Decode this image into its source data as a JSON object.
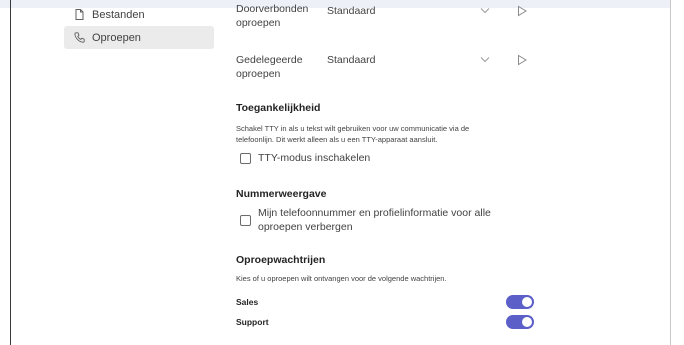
{
  "sidebar": {
    "items": [
      {
        "label": "Bestanden",
        "icon": "file-icon"
      },
      {
        "label": "Oproepen",
        "icon": "phone-icon",
        "active": true
      }
    ]
  },
  "calls": {
    "forwarded": {
      "label_line1": "Doorverbonden",
      "label_line2": "oproepen",
      "value": "Standaard"
    },
    "delegated": {
      "label_line1": "Gedelegeerde",
      "label_line2": "oproepen",
      "value": "Standaard"
    }
  },
  "accessibility": {
    "title": "Toegankelijkheid",
    "description_line1": "Schakel TTY in als u tekst wilt gebruiken voor uw communicatie via de",
    "description_line2": "telefoonlijn. Dit werkt alleen als u een TTY-apparaat aansluit.",
    "tty_label": "TTY-modus inschakelen",
    "tty_checked": false
  },
  "caller_id": {
    "title": "Nummerweergave",
    "hide_label_line1": "Mijn telefoonnummer en profielinformatie voor alle",
    "hide_label_line2": "oproepen verbergen",
    "hide_checked": false
  },
  "call_queues": {
    "title": "Oproepwachtrijen",
    "description": "Kies of u oproepen wilt ontvangen voor de volgende wachtrijen.",
    "queues": [
      {
        "name": "Sales",
        "enabled": true
      },
      {
        "name": "Support",
        "enabled": true
      }
    ]
  },
  "colors": {
    "accent": "#5b5fc7"
  }
}
